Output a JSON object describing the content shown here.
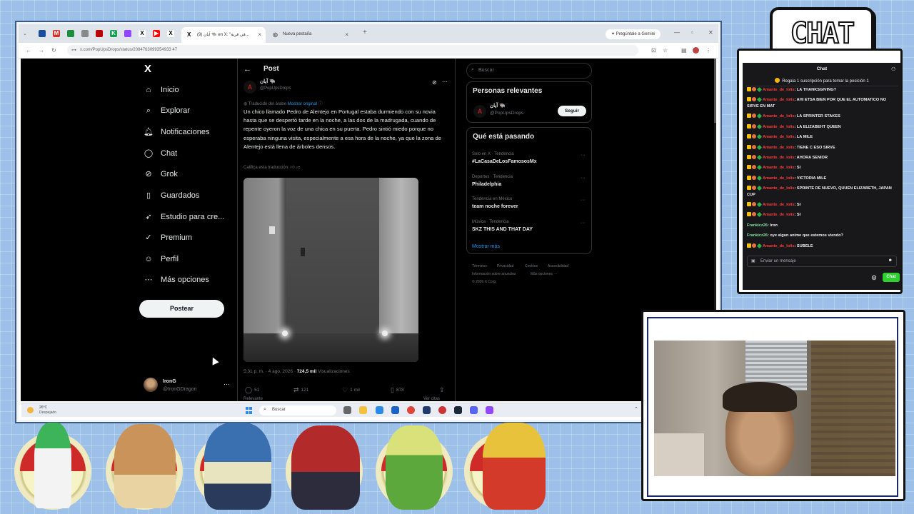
{
  "browser": {
    "tabs": [
      {
        "label": "(9) آيان 🐃 en X: \"في قرية...",
        "active": true
      },
      {
        "label": "Nueva pestaña",
        "active": false
      }
    ],
    "gemini_label": "Pregúntale a Gemini",
    "url": "x.com/PopUpsDrops/status/2084763099354933 47"
  },
  "x": {
    "logo": "X",
    "nav": [
      {
        "label": "Inicio",
        "icon": "home-icon",
        "glyph": "⌂"
      },
      {
        "label": "Explorar",
        "icon": "search-icon",
        "glyph": "⌕"
      },
      {
        "label": "Notificaciones",
        "icon": "bell-icon",
        "glyph": "🔔︎"
      },
      {
        "label": "Chat",
        "icon": "chat-bubble-icon",
        "glyph": "◯"
      },
      {
        "label": "Grok",
        "icon": "grok-icon",
        "glyph": "⊘"
      },
      {
        "label": "Guardados",
        "icon": "bookmark-icon",
        "glyph": "▯"
      },
      {
        "label": "Estudio para cre...",
        "icon": "rocket-icon",
        "glyph": "➶"
      },
      {
        "label": "Premium",
        "icon": "premium-icon",
        "glyph": "✓"
      },
      {
        "label": "Perfil",
        "icon": "user-icon",
        "glyph": "☺"
      },
      {
        "label": "Más opciones",
        "icon": "more-circle-icon",
        "glyph": "⋯"
      }
    ],
    "post_button": "Postear",
    "account": {
      "name": "IronG",
      "handle": "@IronGDragon"
    },
    "post": {
      "header": "Post",
      "author_name": "آيان 🐃",
      "author_handle": "@PopUpsDrops",
      "translated_from": "Traducido del árabe",
      "show_original": "Mostrar original",
      "body": "Un chico llamado Pedro de Alentejo en Portugal estaba durmiendo con su novia hasta que se despertó tarde en la noche, a las dos de la madrugada, cuando de repente oyeron la voz de una chica en su puerta. Pedro sintió miedo porque no esperaba ninguna visita, especialmente a esa hora de la noche, ya que la zona de Alentejo está llena de árboles densos.",
      "rate_translation": "Califica esta traducción:",
      "time": "5:31 p. m. · 4 ago. 2026 ·",
      "views": "724,5 mil",
      "views_label": "Visualizaciones",
      "replies": "51",
      "reposts": "121",
      "likes": "1 mil",
      "bookmarks": "878",
      "related": "Relevante",
      "see_answers": "Ver citas"
    },
    "search_placeholder": "Buscar",
    "relevant_title": "Personas relevantes",
    "relevant_person": {
      "name": "آيان 🐃",
      "handle": "@PopUpsDrops",
      "follow": "Seguir"
    },
    "trending_title": "Qué está pasando",
    "trends": [
      {
        "category": "Solo en X · Tendencia",
        "name": "#LaCasaDeLosFamososMx"
      },
      {
        "category": "Deportes · Tendencia",
        "name": "Philadelphia"
      },
      {
        "category": "Tendencia en México",
        "name": "team noche forever"
      },
      {
        "category": "Música · Tendencia",
        "name": "SKZ THIS AND THAT DAY"
      }
    ],
    "show_more": "Mostrar más",
    "footer": [
      "Términos",
      "Privacidad",
      "Cookies",
      "Accesibilidad",
      "Información sobre anuncios",
      "Más opciones ···",
      "© 2026 X Corp."
    ]
  },
  "taskbar": {
    "temp": "26°C",
    "condition": "Despejado",
    "search": "Buscar"
  },
  "chat": {
    "logo": "CHAT",
    "title": "Chat",
    "pinned": "Regala 1 suscripción para tomar la posición 1",
    "messages": [
      {
        "user": "Amante_de_lolis",
        "text": ": LA THANKSGIVING?",
        "color": "red"
      },
      {
        "user": "Amante_de_lolis",
        "text": ": AHI ETSA BIEN POR QUE EL AUTOMATICO NO SIRVE EN MAT",
        "color": "red"
      },
      {
        "user": "Amante_de_lolis",
        "text": ": LA SPRINTER STAKES",
        "color": "red"
      },
      {
        "user": "Amante_de_lolis",
        "text": ": LA ELIZABEHT QUEEN",
        "color": "red"
      },
      {
        "user": "Amante_de_lolis",
        "text": ": LA MILE",
        "color": "red"
      },
      {
        "user": "Amante_de_lolis",
        "text": ": TIENE C ESO SIRVE",
        "color": "red"
      },
      {
        "user": "Amante_de_lolis",
        "text": ": AHORA SENIOR",
        "color": "red"
      },
      {
        "user": "Amante_de_lolis",
        "text": ": SI",
        "color": "red"
      },
      {
        "user": "Amante_de_lolis",
        "text": ": VICTORIA MILE",
        "color": "red"
      },
      {
        "user": "Amante_de_lolis",
        "text": ": SPRINTE DE NUEVO, QUUEN ELIZABETH, JAPAN CUP",
        "color": "red"
      },
      {
        "user": "Amante_de_lolis",
        "text": ": SI",
        "color": "red"
      },
      {
        "user": "Amante_de_lolis",
        "text": ": SI",
        "color": "red"
      },
      {
        "user": "Frankicz26",
        "text": ": Iron",
        "color": "green"
      },
      {
        "user": "Frankicz26",
        "text": ": oye algun anime que estemos viendo?",
        "color": "green"
      },
      {
        "user": "Amante_de_lolis",
        "text": ": SUBELE",
        "color": "red"
      }
    ],
    "input_placeholder": "Enviar un mensaje",
    "send_label": "Chat"
  }
}
